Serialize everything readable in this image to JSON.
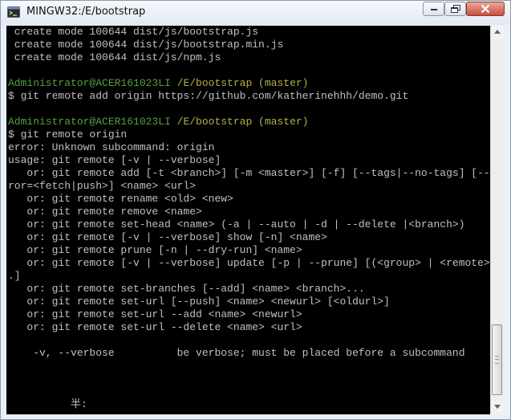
{
  "window": {
    "title": "MINGW32:/E/bootstrap",
    "icon": "git-bash-icon",
    "controls": {
      "minimize": "minimize-icon",
      "maximize": "maximize-icon",
      "close": "close-icon"
    }
  },
  "colors": {
    "terminal_bg": "#000000",
    "terminal_text": "#c0c0c0",
    "user_host": "#55a041",
    "path_branch": "#b5b04a"
  },
  "terminal": {
    "lines": [
      {
        "text": " create mode 100644 dist/js/bootstrap.js"
      },
      {
        "text": " create mode 100644 dist/js/bootstrap.min.js"
      },
      {
        "text": " create mode 100644 dist/js/npm.js"
      },
      {
        "text": ""
      },
      {
        "prompt_user": "Administrator@ACER161023LI",
        "prompt_path": " /E/bootstrap (master)"
      },
      {
        "text": "$ git remote add origin https://github.com/katherinehhh/demo.git"
      },
      {
        "text": ""
      },
      {
        "prompt_user": "Administrator@ACER161023LI",
        "prompt_path": " /E/bootstrap (master)"
      },
      {
        "text": "$ git remote origin"
      },
      {
        "text": "error: Unknown subcommand: origin"
      },
      {
        "text": "usage: git remote [-v | --verbose]"
      },
      {
        "text": "   or: git remote add [-t <branch>] [-m <master>] [-f] [--tags|--no-tags] [--mirror"
      },
      {
        "text": "ror=<fetch|push>] <name> <url>"
      },
      {
        "text": "   or: git remote rename <old> <new>"
      },
      {
        "text": "   or: git remote remove <name>"
      },
      {
        "text": "   or: git remote set-head <name> (-a | --auto | -d | --delete |<branch>)"
      },
      {
        "text": "   or: git remote [-v | --verbose] show [-n] <name>"
      },
      {
        "text": "   or: git remote prune [-n | --dry-run] <name>"
      },
      {
        "text": "   or: git remote [-v | --verbose] update [-p | --prune] [(<group> | <remote>)...]"
      },
      {
        "text": ".]"
      },
      {
        "text": "   or: git remote set-branches [--add] <name> <branch>..."
      },
      {
        "text": "   or: git remote set-url [--push] <name> <newurl> [<oldurl>]"
      },
      {
        "text": "   or: git remote set-url --add <name> <newurl>"
      },
      {
        "text": "   or: git remote set-url --delete <name> <url>"
      },
      {
        "text": ""
      },
      {
        "text": "    -v, --verbose          be verbose; must be placed before a subcommand"
      },
      {
        "text": ""
      },
      {
        "text": ""
      },
      {
        "text": ""
      },
      {
        "text": "          半:"
      }
    ]
  },
  "scrollbar": {
    "up_icon": "scroll-up-arrow-icon",
    "down_icon": "scroll-down-arrow-icon",
    "position_fraction": 0.95
  }
}
